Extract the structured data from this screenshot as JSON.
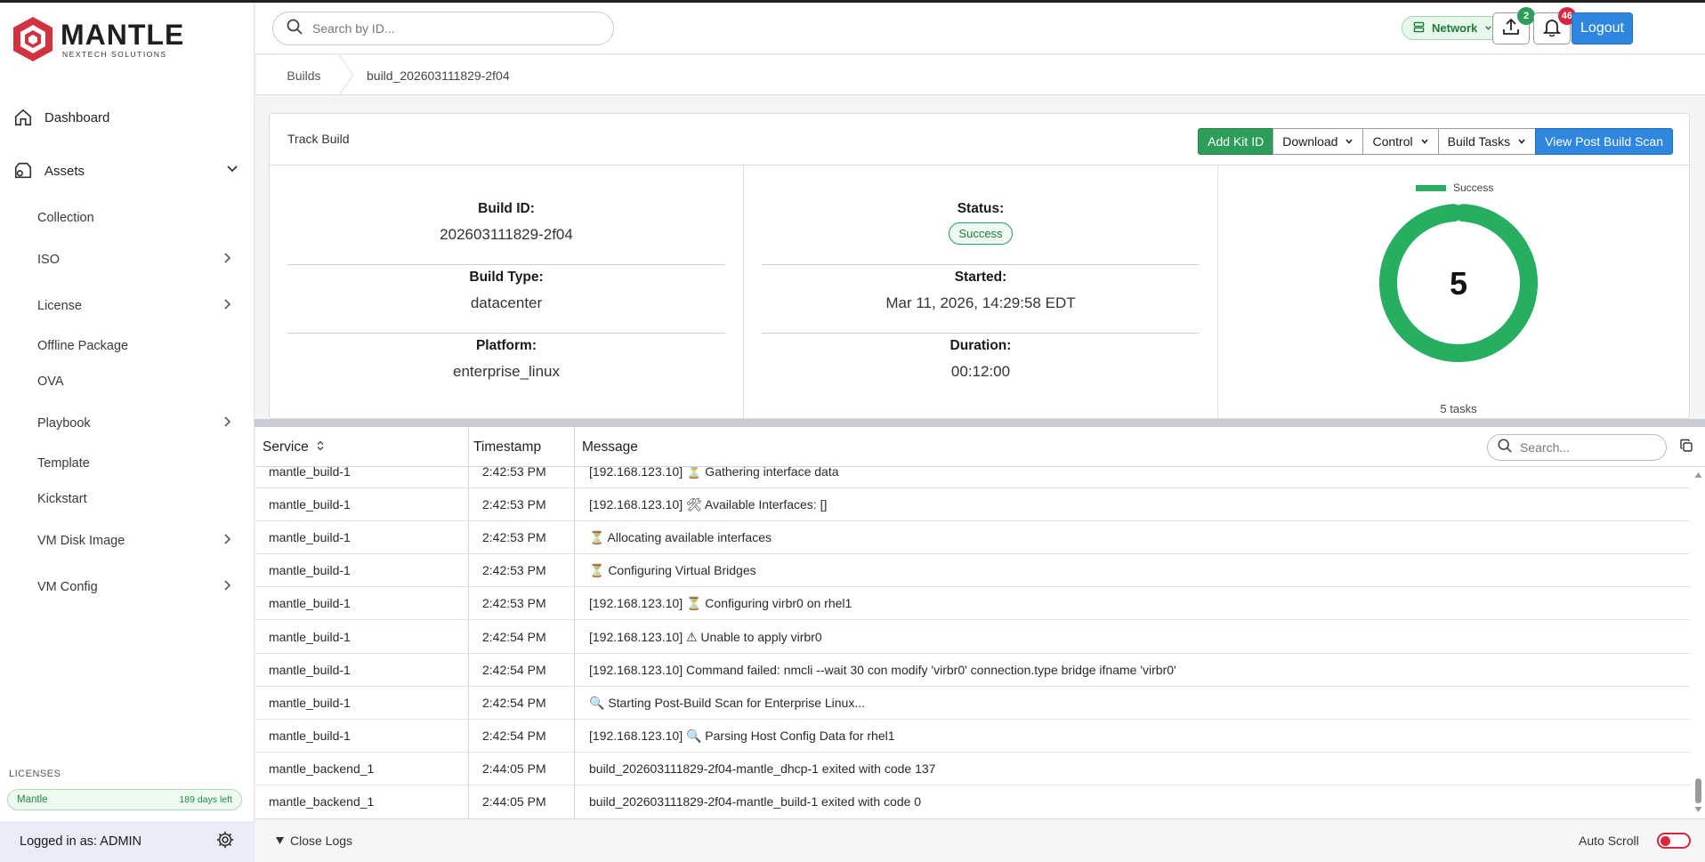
{
  "brand": {
    "name": "MANTLE",
    "tagline": "NEXTECH SOLUTIONS"
  },
  "sidebar": {
    "dashboard": "Dashboard",
    "assets": "Assets",
    "items": [
      {
        "label": "Collection"
      },
      {
        "label": "ISO"
      },
      {
        "label": "License"
      },
      {
        "label": "Offline Package"
      },
      {
        "label": "OVA"
      },
      {
        "label": "Playbook"
      },
      {
        "label": "Template"
      },
      {
        "label": "Kickstart"
      },
      {
        "label": "VM Disk Image"
      },
      {
        "label": "VM Config"
      }
    ],
    "licenses_label": "LICENSES",
    "license_name": "Mantle",
    "license_days": "189 days left",
    "logged_in": "Logged in as: ADMIN"
  },
  "topbar": {
    "search_placeholder": "Search by ID...",
    "network_label": "Network",
    "upload_count": "2",
    "notif_count": "46",
    "logout_label": "Logout"
  },
  "breadcrumb": {
    "root": "Builds",
    "current": "build_202603111829-2f04"
  },
  "track": {
    "title": "Track Build",
    "buttons": {
      "add_kit": "Add Kit ID",
      "download": "Download",
      "control": "Control",
      "build_tasks": "Build Tasks",
      "view_scan": "View Post Build Scan"
    },
    "build_id_label": "Build ID:",
    "build_id": "202603111829-2f04",
    "build_type_label": "Build Type:",
    "build_type": "datacenter",
    "platform_label": "Platform:",
    "platform": "enterprise_linux",
    "status_label": "Status:",
    "status": "Success",
    "started_label": "Started:",
    "started": "Mar 11, 2026, 14:29:58 EDT",
    "duration_label": "Duration:",
    "duration": "00:12:00"
  },
  "chart_data": {
    "type": "pie",
    "categories": [
      "Success"
    ],
    "values": [
      5
    ],
    "center_label": "5",
    "caption": "5 tasks",
    "colors": {
      "Success": "#27ae60"
    }
  },
  "logs": {
    "headers": {
      "service": "Service",
      "timestamp": "Timestamp",
      "message": "Message"
    },
    "search_placeholder": "Search...",
    "rows": [
      {
        "service": "mantle_build-1",
        "timestamp": "2:42:53 PM",
        "message": "[192.168.123.10] ⏳ Gathering interface data"
      },
      {
        "service": "mantle_build-1",
        "timestamp": "2:42:53 PM",
        "message": "[192.168.123.10] 🛠 Available Interfaces: []"
      },
      {
        "service": "mantle_build-1",
        "timestamp": "2:42:53 PM",
        "message": "⏳ Allocating available interfaces"
      },
      {
        "service": "mantle_build-1",
        "timestamp": "2:42:53 PM",
        "message": "⏳ Configuring Virtual Bridges"
      },
      {
        "service": "mantle_build-1",
        "timestamp": "2:42:53 PM",
        "message": "[192.168.123.10] ⏳ Configuring virbr0 on rhel1"
      },
      {
        "service": "mantle_build-1",
        "timestamp": "2:42:54 PM",
        "message": "[192.168.123.10] ⚠ Unable to apply virbr0"
      },
      {
        "service": "mantle_build-1",
        "timestamp": "2:42:54 PM",
        "message": "[192.168.123.10] Command failed: nmcli --wait 30 con modify 'virbr0' connection.type bridge ifname 'virbr0'"
      },
      {
        "service": "mantle_build-1",
        "timestamp": "2:42:54 PM",
        "message": "🔍 Starting Post-Build Scan for Enterprise Linux..."
      },
      {
        "service": "mantle_build-1",
        "timestamp": "2:42:54 PM",
        "message": "[192.168.123.10] 🔍 Parsing Host Config Data for rhel1"
      },
      {
        "service": "mantle_backend_1",
        "timestamp": "2:44:05 PM",
        "message": "build_202603111829-2f04-mantle_dhcp-1 exited with code 137"
      },
      {
        "service": "mantle_backend_1",
        "timestamp": "2:44:05 PM",
        "message": "build_202603111829-2f04-mantle_build-1 exited with code 0"
      }
    ],
    "close_label": "Close Logs",
    "autoscroll_label": "Auto Scroll"
  }
}
